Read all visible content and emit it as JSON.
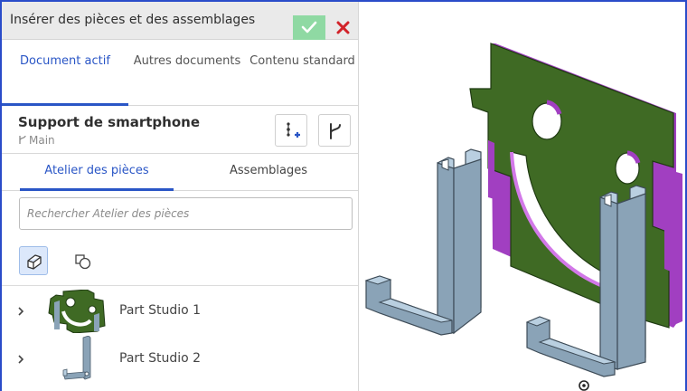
{
  "dialog": {
    "title": "Insérer des pièces et des assemblages",
    "ok_icon": "check-icon",
    "close_icon": "close-icon"
  },
  "source_tabs": [
    {
      "label": "Document actif",
      "active": true
    },
    {
      "label": "Autres documents",
      "active": false
    },
    {
      "label": "Contenu standard",
      "active": false
    }
  ],
  "document": {
    "name": "Support de smartphone",
    "branch": "Main",
    "branch_icon": "branch-icon",
    "buttons": [
      {
        "icon": "insert-version-icon"
      },
      {
        "icon": "branch-versions-icon"
      }
    ]
  },
  "sub_tabs": [
    {
      "label": "Atelier des pièces",
      "active": true
    },
    {
      "label": "Assemblages",
      "active": false
    }
  ],
  "search": {
    "placeholder": "Rechercher Atelier des pièces",
    "value": ""
  },
  "filters": [
    {
      "icon": "part-filter-icon",
      "active": true
    },
    {
      "icon": "surface-filter-icon",
      "active": false
    }
  ],
  "items": [
    {
      "label": "Part Studio 1",
      "thumb_icon": "face-plate-thumbnail"
    },
    {
      "label": "Part Studio 2",
      "thumb_icon": "stand-thumbnail"
    }
  ],
  "colors": {
    "accent": "#2a56c6",
    "frame": "#2a4cc9",
    "ok_button": "#8fd9a3",
    "close": "#d2232a",
    "plate_green": "#3f6a24",
    "plate_edge": "#a13fc1",
    "stand_face": "#8aa3b7",
    "stand_light": "#b9cfe0"
  }
}
